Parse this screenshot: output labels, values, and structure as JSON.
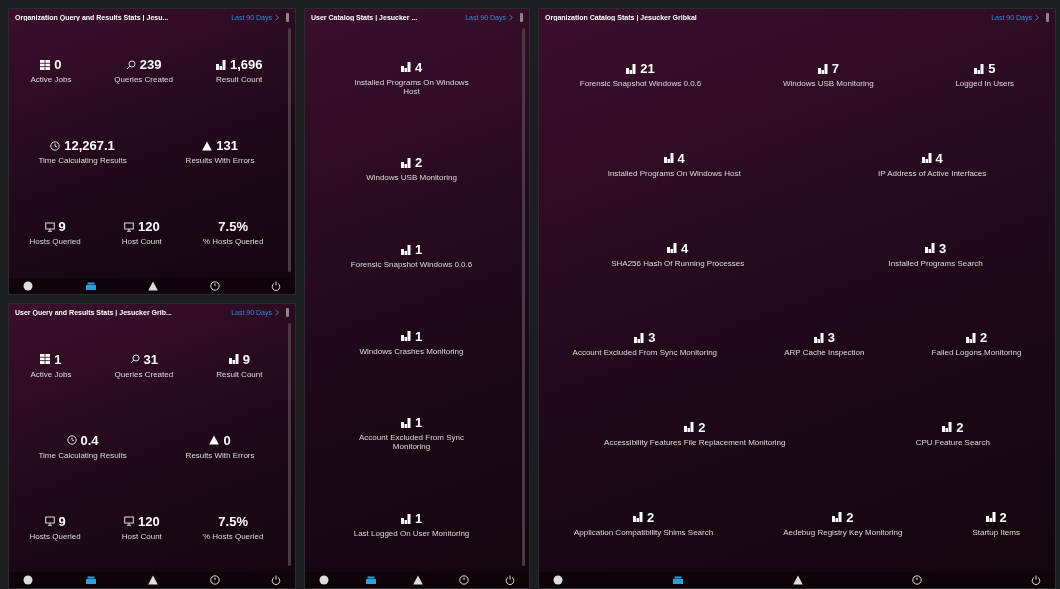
{
  "panels": [
    {
      "title": "Organization Query and Results Stats | Jesu...",
      "link": "Last 90 Days",
      "scrollbar": true,
      "rows": [
        {
          "stats": [
            {
              "kind": "jobs",
              "value": "0",
              "label": "Active Jobs"
            },
            {
              "kind": "search",
              "value": "239",
              "label": "Queries Created"
            },
            {
              "kind": "chart",
              "value": "1,696",
              "label": "Result Count"
            }
          ]
        },
        {
          "stats": [
            {
              "kind": "clock",
              "value": "12,267.1",
              "label": "Time Calculating Results"
            },
            {
              "kind": "warning",
              "value": "131",
              "label": "Results With Errors"
            }
          ]
        },
        {
          "stats": [
            {
              "kind": "monitor",
              "value": "9",
              "label": "Hosts Queried"
            },
            {
              "kind": "monitor",
              "value": "120",
              "label": "Host Count"
            },
            {
              "kind": "plain",
              "value": "7.5%",
              "label": "% Hosts Queried"
            }
          ]
        }
      ],
      "nav": [
        {
          "kind": "circle",
          "selected": false
        },
        {
          "kind": "stack",
          "selected": true
        },
        {
          "kind": "warning",
          "selected": false
        },
        {
          "kind": "clock",
          "selected": false
        },
        {
          "kind": "power",
          "selected": false
        }
      ]
    },
    {
      "title": "User Query and Results Stats | Jesucker Grib...",
      "link": "Last 90 Days",
      "scrollbar": true,
      "rows": [
        {
          "stats": [
            {
              "kind": "jobs",
              "value": "1",
              "label": "Active Jobs"
            },
            {
              "kind": "search",
              "value": "31",
              "label": "Queries Created"
            },
            {
              "kind": "chart",
              "value": "9",
              "label": "Result Count"
            }
          ]
        },
        {
          "stats": [
            {
              "kind": "clock",
              "value": "0.4",
              "label": "Time Calculating Results"
            },
            {
              "kind": "warning",
              "value": "0",
              "label": "Results With Errors"
            }
          ]
        },
        {
          "stats": [
            {
              "kind": "monitor",
              "value": "9",
              "label": "Hosts Queried"
            },
            {
              "kind": "monitor",
              "value": "120",
              "label": "Host Count"
            },
            {
              "kind": "plain",
              "value": "7.5%",
              "label": "% Hosts Queried"
            }
          ]
        }
      ],
      "nav": [
        {
          "kind": "circle",
          "selected": false
        },
        {
          "kind": "stack",
          "selected": true
        },
        {
          "kind": "warning",
          "selected": false
        },
        {
          "kind": "clock",
          "selected": false
        },
        {
          "kind": "power",
          "selected": false
        }
      ]
    },
    {
      "title": "User Catalog Stats | Jesucker ...",
      "link": "Last 90 Days",
      "scrollbar": true,
      "rows": [
        {
          "stats": [
            {
              "kind": "chart",
              "value": "4",
              "label": "Installed Programs On Windows Host"
            }
          ]
        },
        {
          "stats": [
            {
              "kind": "chart",
              "value": "2",
              "label": "Windows USB Monitoring"
            }
          ]
        },
        {
          "stats": [
            {
              "kind": "chart",
              "value": "1",
              "label": "Forensic Snapshot Windows 0.0.6"
            }
          ]
        },
        {
          "stats": [
            {
              "kind": "chart",
              "value": "1",
              "label": "Windows Crashes Monitoring"
            }
          ]
        },
        {
          "stats": [
            {
              "kind": "chart",
              "value": "1",
              "label": "Account Excluded From Sync Monitoring"
            }
          ]
        },
        {
          "stats": [
            {
              "kind": "chart",
              "value": "1",
              "label": "Last Logged On User Monitoring"
            }
          ]
        }
      ],
      "nav": [
        {
          "kind": "circle",
          "selected": false
        },
        {
          "kind": "stack",
          "selected": true
        },
        {
          "kind": "warning",
          "selected": false
        },
        {
          "kind": "clock",
          "selected": false
        },
        {
          "kind": "power",
          "selected": false
        }
      ]
    },
    {
      "title": "Organization Catalog Stats | Jesucker Gribkal",
      "link": "Last 90 Days",
      "scrollbar": false,
      "rows": [
        {
          "stats": [
            {
              "kind": "chart",
              "value": "21",
              "label": "Forensic Snapshot Windows 0.0.6"
            },
            {
              "kind": "chart",
              "value": "7",
              "label": "Windows USB Monitoring"
            },
            {
              "kind": "chart",
              "value": "5",
              "label": "Logged In Users"
            }
          ]
        },
        {
          "stats": [
            {
              "kind": "chart",
              "value": "4",
              "label": "Installed Programs On Windows Host"
            },
            {
              "kind": "chart",
              "value": "4",
              "label": "IP Address of Active Interfaces"
            }
          ]
        },
        {
          "stats": [
            {
              "kind": "chart",
              "value": "4",
              "label": "SHA256 Hash Of Running Processes"
            },
            {
              "kind": "chart",
              "value": "3",
              "label": "Installed Programs Search"
            }
          ]
        },
        {
          "stats": [
            {
              "kind": "chart",
              "value": "3",
              "label": "Account Excluded From Sync Monitoring"
            },
            {
              "kind": "chart",
              "value": "3",
              "label": "ARP Cache Inspection"
            },
            {
              "kind": "chart",
              "value": "2",
              "label": "Failed Logons Monitoring"
            }
          ]
        },
        {
          "stats": [
            {
              "kind": "chart",
              "value": "2",
              "label": "Accessibility Features File Replacement Monitoring"
            },
            {
              "kind": "chart",
              "value": "2",
              "label": "CPU Feature Search"
            }
          ]
        },
        {
          "stats": [
            {
              "kind": "chart",
              "value": "2",
              "label": "Application Compatibility Shims Search"
            },
            {
              "kind": "chart",
              "value": "2",
              "label": "Aedebug Registry Key Monitoring"
            },
            {
              "kind": "chart",
              "value": "2",
              "label": "Startup Items"
            }
          ]
        }
      ],
      "nav": [
        {
          "kind": "circle",
          "selected": false
        },
        {
          "kind": "stack",
          "selected": true
        },
        {
          "kind": "warning",
          "selected": false
        },
        {
          "kind": "clock",
          "selected": false
        },
        {
          "kind": "power",
          "selected": false
        }
      ]
    }
  ]
}
